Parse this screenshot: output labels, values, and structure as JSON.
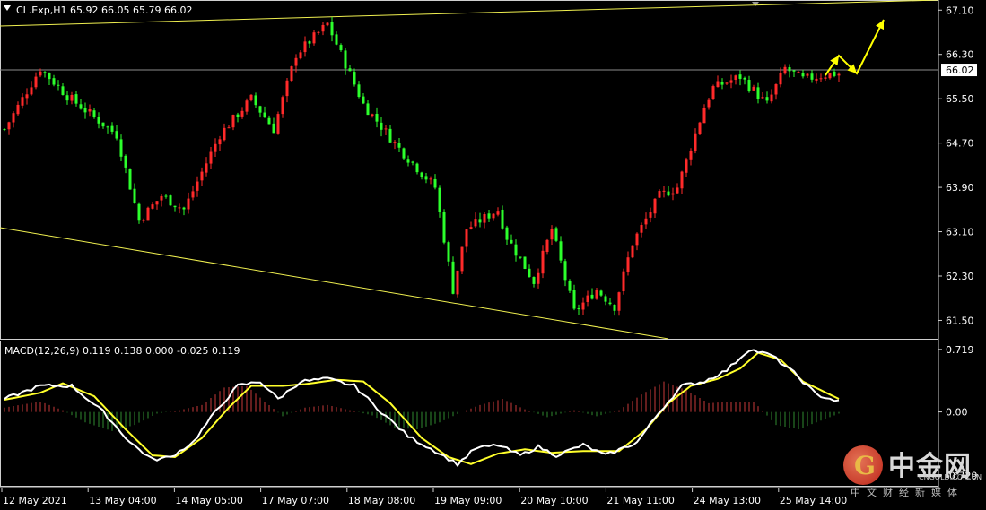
{
  "chart_data": {
    "type": "candlestick",
    "symbol_info": "CL.Exp,H1  65.92 66.05 65.79 66.02",
    "price_axis": {
      "range": [
        61.2,
        67.25
      ],
      "ticks": [
        "67.10",
        "66.30",
        "65.50",
        "64.70",
        "63.90",
        "63.10",
        "62.30",
        "61.50"
      ],
      "current_price": "66.02"
    },
    "time_labels": [
      "12 May 2021",
      "13 May 04:00",
      "14 May 05:00",
      "17 May 07:00",
      "18 May 08:00",
      "19 May 09:00",
      "20 May 10:00",
      "21 May 11:00",
      "24 May 13:00",
      "25 May 14:00"
    ],
    "close_path": [
      [
        0,
        64.95
      ],
      [
        8,
        66.05
      ],
      [
        14,
        65.55
      ],
      [
        25,
        64.85
      ],
      [
        30,
        63.3
      ],
      [
        35,
        63.75
      ],
      [
        40,
        63.5
      ],
      [
        48,
        64.85
      ],
      [
        55,
        65.5
      ],
      [
        60,
        64.95
      ],
      [
        65,
        66.3
      ],
      [
        72,
        66.85
      ],
      [
        80,
        65.4
      ],
      [
        88,
        64.6
      ],
      [
        96,
        63.9
      ],
      [
        100,
        62.05
      ],
      [
        103,
        63.15
      ],
      [
        110,
        63.5
      ],
      [
        112,
        63.0
      ],
      [
        118,
        62.2
      ],
      [
        122,
        63.15
      ],
      [
        127,
        61.65
      ],
      [
        132,
        62.05
      ],
      [
        136,
        61.75
      ],
      [
        140,
        62.9
      ],
      [
        146,
        63.75
      ],
      [
        150,
        63.9
      ],
      [
        156,
        65.35
      ],
      [
        158,
        65.7
      ],
      [
        164,
        65.9
      ],
      [
        170,
        65.4
      ],
      [
        174,
        66.05
      ],
      [
        178,
        65.85
      ],
      [
        184,
        65.95
      ]
    ],
    "projection_path": [
      [
        920,
        84
      ],
      [
        935,
        62
      ],
      [
        955,
        82
      ],
      [
        985,
        22
      ]
    ],
    "trendlines": [
      {
        "from": [
          0,
          29
        ],
        "to": [
          1046,
          0
        ]
      },
      {
        "from": [
          0,
          254
        ],
        "to": [
          745,
          378
        ]
      }
    ],
    "macd": {
      "label": "MACD(12,26,9) 0.119 0.138 0.000 -0.025 0.119",
      "range": [
        -0.85,
        0.8
      ],
      "ticks": [
        "0.719",
        "0.00",
        "-0.729"
      ],
      "macd_line": [
        [
          0,
          0.15
        ],
        [
          8,
          0.3
        ],
        [
          15,
          0.3
        ],
        [
          22,
          0.0
        ],
        [
          28,
          -0.35
        ],
        [
          33,
          -0.55
        ],
        [
          37,
          -0.52
        ],
        [
          42,
          -0.35
        ],
        [
          47,
          0.0
        ],
        [
          52,
          0.3
        ],
        [
          57,
          0.35
        ],
        [
          61,
          0.15
        ],
        [
          66,
          0.35
        ],
        [
          72,
          0.38
        ],
        [
          78,
          0.3
        ],
        [
          84,
          0.0
        ],
        [
          90,
          -0.28
        ],
        [
          96,
          -0.45
        ],
        [
          101,
          -0.6
        ],
        [
          105,
          -0.42
        ],
        [
          110,
          -0.38
        ],
        [
          115,
          -0.5
        ],
        [
          119,
          -0.4
        ],
        [
          123,
          -0.5
        ],
        [
          129,
          -0.38
        ],
        [
          134,
          -0.5
        ],
        [
          141,
          -0.35
        ],
        [
          146,
          0.0
        ],
        [
          151,
          0.3
        ],
        [
          156,
          0.35
        ],
        [
          161,
          0.48
        ],
        [
          166,
          0.72
        ],
        [
          171,
          0.65
        ],
        [
          176,
          0.45
        ],
        [
          181,
          0.2
        ],
        [
          186,
          0.12
        ]
      ],
      "signal_line": [
        [
          0,
          0.14
        ],
        [
          8,
          0.22
        ],
        [
          13,
          0.33
        ],
        [
          20,
          0.18
        ],
        [
          27,
          -0.2
        ],
        [
          33,
          -0.5
        ],
        [
          38,
          -0.52
        ],
        [
          44,
          -0.3
        ],
        [
          50,
          0.05
        ],
        [
          55,
          0.3
        ],
        [
          62,
          0.3
        ],
        [
          67,
          0.32
        ],
        [
          74,
          0.37
        ],
        [
          80,
          0.35
        ],
        [
          86,
          0.1
        ],
        [
          93,
          -0.3
        ],
        [
          99,
          -0.52
        ],
        [
          104,
          -0.6
        ],
        [
          110,
          -0.48
        ],
        [
          116,
          -0.43
        ],
        [
          122,
          -0.47
        ],
        [
          129,
          -0.45
        ],
        [
          137,
          -0.45
        ],
        [
          143,
          -0.2
        ],
        [
          148,
          0.1
        ],
        [
          153,
          0.3
        ],
        [
          159,
          0.38
        ],
        [
          164,
          0.5
        ],
        [
          168,
          0.68
        ],
        [
          173,
          0.6
        ],
        [
          178,
          0.35
        ],
        [
          186,
          0.15
        ]
      ],
      "hist_profile": [
        [
          0,
          0.05
        ],
        [
          8,
          0.12
        ],
        [
          13,
          0.02
        ],
        [
          18,
          -0.12
        ],
        [
          24,
          -0.22
        ],
        [
          29,
          -0.15
        ],
        [
          34,
          -0.02
        ],
        [
          39,
          0.02
        ],
        [
          44,
          0.08
        ],
        [
          49,
          0.28
        ],
        [
          54,
          0.3
        ],
        [
          58,
          0.12
        ],
        [
          62,
          -0.05
        ],
        [
          67,
          0.05
        ],
        [
          72,
          0.08
        ],
        [
          77,
          0.02
        ],
        [
          82,
          -0.04
        ],
        [
          87,
          -0.18
        ],
        [
          92,
          -0.2
        ],
        [
          97,
          -0.12
        ],
        [
          102,
          0.0
        ],
        [
          106,
          0.08
        ],
        [
          111,
          0.15
        ],
        [
          116,
          0.03
        ],
        [
          121,
          -0.06
        ],
        [
          127,
          0.02
        ],
        [
          132,
          -0.05
        ],
        [
          137,
          0.02
        ],
        [
          142,
          0.2
        ],
        [
          147,
          0.35
        ],
        [
          152,
          0.25
        ],
        [
          157,
          0.1
        ],
        [
          162,
          0.12
        ],
        [
          167,
          0.12
        ],
        [
          172,
          -0.15
        ],
        [
          177,
          -0.2
        ],
        [
          182,
          -0.1
        ],
        [
          186,
          -0.02
        ]
      ]
    }
  },
  "watermark": {
    "logo_glyph": "G",
    "name": "中金网",
    "url": "CNGOLD.COM.CN",
    "tagline": "中文财经新媒体"
  },
  "colors": {
    "background": "#000000",
    "up_candle": "#ff2a2a",
    "down_candle": "#2cff2c",
    "trendline": "#f0f050",
    "projection_arrow": "#ffff00",
    "macd_line": "#ffffff",
    "signal_line": "#ffff2a",
    "hist_up": "#c83a3a",
    "hist_down": "#2f8a2f",
    "axis_text": "#ffffff",
    "frame": "#ffffff"
  }
}
